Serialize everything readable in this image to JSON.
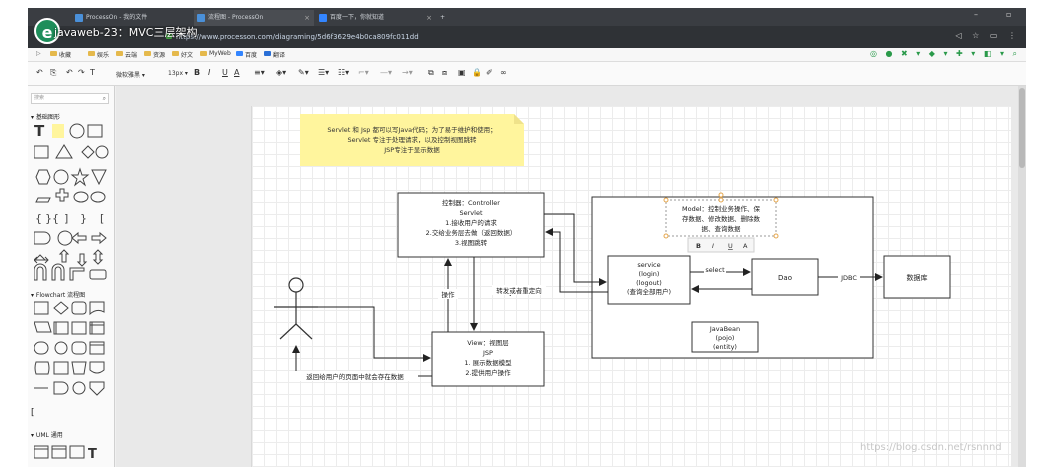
{
  "browser": {
    "tabs": [
      {
        "label": "ProcessOn - 我的文件"
      },
      {
        "label": "流程图 - ProcessOn"
      },
      {
        "label": "百度一下，你就知道"
      }
    ],
    "url": "https://www.processon.com/diagraming/5d6f3629e4b0ca809fc011dd",
    "overlay_title": "javaweb-23：MVC三层架构",
    "app_logo_letter": "e"
  },
  "bookmarks": {
    "items": [
      "收藏",
      "娱乐",
      "云端",
      "资源",
      "好文",
      "MyWeb",
      "百度",
      "翻译"
    ]
  },
  "toolbar": {
    "font_name": "微软雅黑",
    "font_size": "13px",
    "bold": "B",
    "italic": "I",
    "underline": "U",
    "font_color": "A"
  },
  "left_panel": {
    "search_placeholder": "搜索",
    "sections": [
      "基础图形",
      "Flowchart 流程图",
      "UML 通用"
    ]
  },
  "diagram": {
    "note": {
      "line1": "Servlet 和 Jsp  都可以写Java代码；为了易于维护和使用；",
      "line2": "Servlet 专注于处理请求，以及控制视图跳转",
      "line3": "JSP专注于显示数据"
    },
    "controller": {
      "line1": "控制器：Controller",
      "line2": "Servlet",
      "line3": "1.接收用户的请求",
      "line4": "2.交给业务层去做（返回数据）",
      "line5": "3.视图跳转"
    },
    "view": {
      "line1": "View：视图层",
      "line2": "JSP",
      "line3": "1. 展示数据模型",
      "line4": "2.提供用户操作"
    },
    "model": {
      "line1": "Model：控制业务操作、保",
      "line2": "存数据、修改数据、删除数",
      "line3": "据、查询数据"
    },
    "service": {
      "line1": "service",
      "line2": "(login)",
      "line3": "(logout)",
      "line4": "(查询全部用户)"
    },
    "dao": "Dao",
    "db": "数据库",
    "javabean": {
      "line1": "JavaBean",
      "line2": "(pojo)",
      "line3": "(entity)"
    },
    "labels": {
      "operate": "操作",
      "forward": "转发或者重定向",
      "select": "select",
      "jdbc": "JDBC",
      "return_user": "返回给用户的页面中就会存在数据"
    },
    "mini_toolbar": [
      "B",
      "I",
      "U",
      "A"
    ]
  },
  "watermark": "https://blog.csdn.net/rsnnnd",
  "colors": {
    "note_bg": "#fff59d",
    "accent": "#1e8e5a",
    "arrow": "#222222"
  }
}
